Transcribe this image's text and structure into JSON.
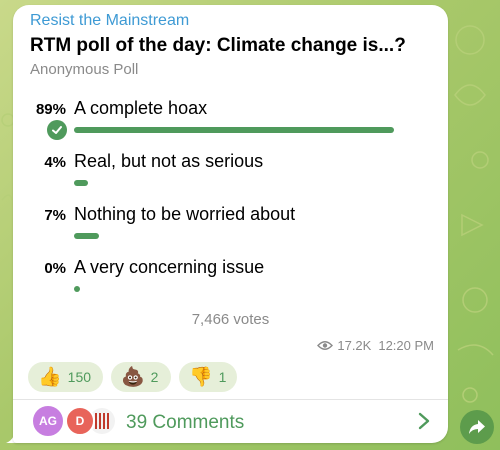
{
  "post": {
    "channel_name": "Resist the Mainstream",
    "question": "RTM poll of the day: Climate change is...?",
    "poll_type": "Anonymous Poll"
  },
  "poll": {
    "options": [
      {
        "percent": "89%",
        "label": "A complete hoax",
        "fraction": 0.89,
        "chosen": true
      },
      {
        "percent": "4%",
        "label": "Real, but not as serious",
        "fraction": 0.04,
        "chosen": false
      },
      {
        "percent": "7%",
        "label": "Nothing to be worried about",
        "fraction": 0.07,
        "chosen": false
      },
      {
        "percent": "0%",
        "label": "A very concerning issue",
        "fraction": 0.0,
        "chosen": false
      }
    ],
    "total_votes": "7,466 votes"
  },
  "meta": {
    "views": "17.2K",
    "time": "12:20 PM"
  },
  "reactions": [
    {
      "icon": "thumbs-up-icon",
      "emoji": "👍",
      "count": "150"
    },
    {
      "icon": "poop-icon",
      "emoji": "💩",
      "count": "2"
    },
    {
      "icon": "thumbs-down-icon",
      "emoji": "👎",
      "count": "1"
    }
  ],
  "comments": {
    "label": "39 Comments",
    "avatars": [
      {
        "initials": "AG",
        "color": "#c77ee0"
      },
      {
        "initials": "D",
        "color": "#e8645a"
      },
      {
        "initials": "",
        "color": "#d9d9d9"
      }
    ]
  },
  "colors": {
    "accent_green": "#4f9a5c",
    "channel_blue": "#3e9ad4",
    "muted_gray": "#8a8a8a"
  }
}
